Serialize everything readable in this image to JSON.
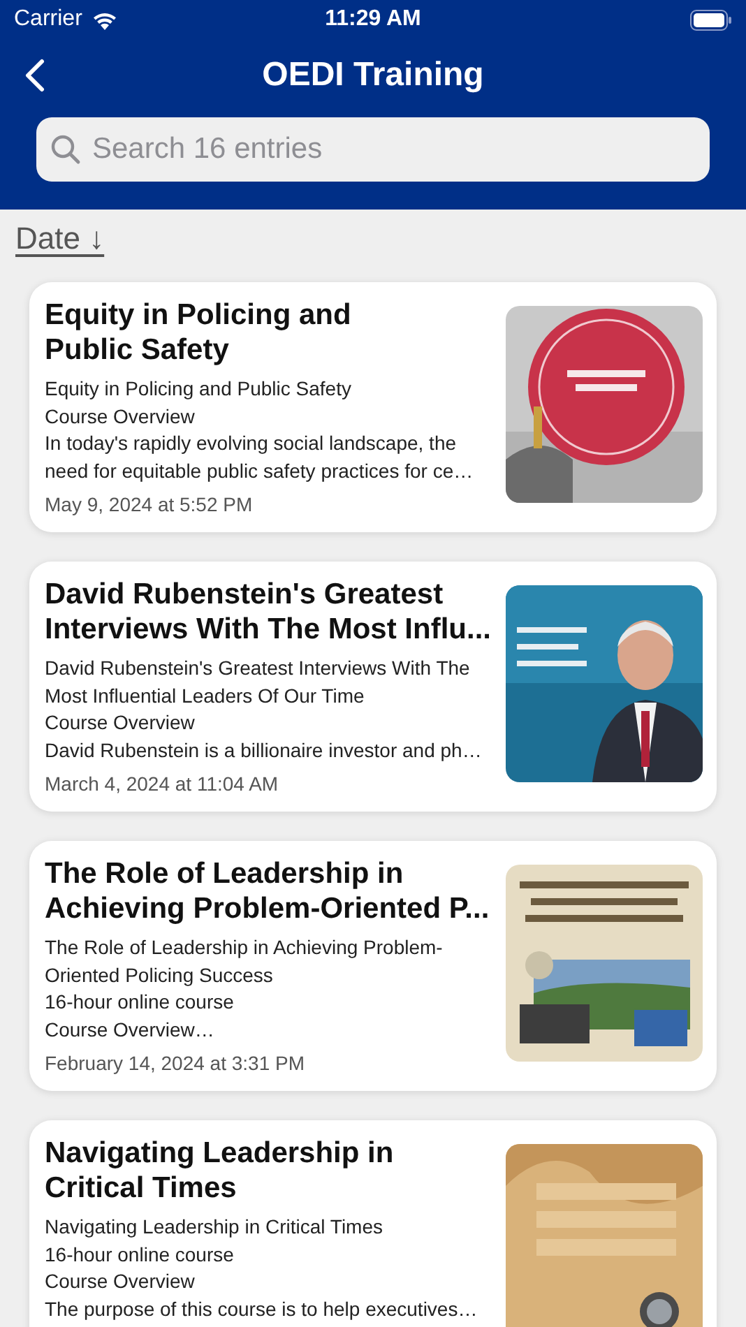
{
  "status_bar": {
    "carrier": "Carrier",
    "time": "11:29 AM"
  },
  "nav": {
    "title": "OEDI Training"
  },
  "search": {
    "placeholder": "Search 16 entries"
  },
  "sort": {
    "label": "Date ↓"
  },
  "entries": [
    {
      "title_lines": [
        "Equity in Policing and",
        "Public Safety"
      ],
      "summary_lines": [
        "Equity in Policing and Public Safety",
        "Course Overview",
        "In today's rapidly evolving social landscape, the",
        "need for equitable public safety practices for ce…"
      ],
      "date": "May 9, 2024 at 5:52 PM"
    },
    {
      "title_lines": [
        "David Rubenstein's Greatest",
        "Interviews With The Most Influ..."
      ],
      "summary_lines": [
        "David Rubenstein's Greatest Interviews With The",
        "Most Influential Leaders Of Our Time",
        "Course Overview",
        "David Rubenstein is a billionaire investor and ph…"
      ],
      "date": "March 4, 2024 at 11:04 AM"
    },
    {
      "title_lines": [
        "The Role of Leadership in",
        "Achieving Problem-Oriented P..."
      ],
      "summary_lines": [
        "The Role of Leadership in Achieving Problem-",
        "Oriented Policing Success",
        "16-hour online course",
        "Course Overview…"
      ],
      "date": "February 14, 2024 at 3:31 PM"
    },
    {
      "title_lines": [
        "Navigating Leadership in",
        "Critical Times"
      ],
      "summary_lines": [
        "Navigating Leadership in Critical Times",
        "16-hour online course",
        "Course Overview",
        "The purpose of this course is to help executives…"
      ]
    }
  ]
}
